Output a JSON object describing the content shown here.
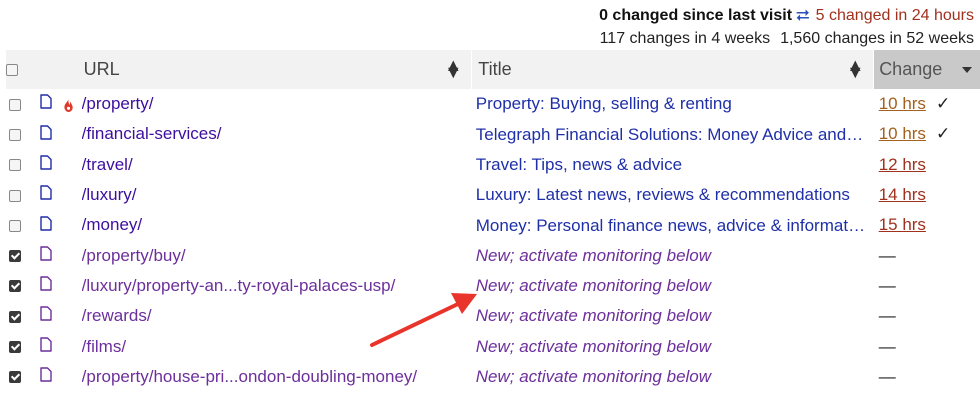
{
  "stats": {
    "since_last_visit": "0 changed since last visit",
    "changed_24h": "5 changed in 24 hours",
    "changes_4w": "117 changes in 4 weeks",
    "changes_52w": "1,560 changes in 52 weeks"
  },
  "columns": {
    "url": "URL",
    "title": "Title",
    "change": "Change"
  },
  "colors": {
    "url_link": "#3d0f9e",
    "new_item": "#6c2f9b",
    "title_link": "#1f2fa8",
    "hrs_orange": "#a3601e",
    "hrs_red": "#a0311d",
    "annotation_arrow": "#e8342a"
  },
  "rows": [
    {
      "checked": false,
      "hot": true,
      "url": "/property/",
      "title": "Property: Buying, selling & renting",
      "change": "10 hrs",
      "seen": "✓"
    },
    {
      "checked": false,
      "hot": false,
      "url": "/financial-services/",
      "title": "Telegraph Financial Solutions: Money Advice and …",
      "change": "10 hrs",
      "seen": "✓"
    },
    {
      "checked": false,
      "hot": false,
      "url": "/travel/",
      "title": "Travel: Tips, news & advice",
      "change": "12 hrs",
      "seen": ""
    },
    {
      "checked": false,
      "hot": false,
      "url": "/luxury/",
      "title": "Luxury: Latest news, reviews & recommendations",
      "change": "14 hrs",
      "seen": ""
    },
    {
      "checked": false,
      "hot": false,
      "url": "/money/",
      "title": "Money: Personal finance news, advice & informati…",
      "change": "15 hrs",
      "seen": ""
    },
    {
      "checked": true,
      "hot": false,
      "url": "/property/buy/",
      "title": "New; activate monitoring below",
      "change": "—",
      "seen": ""
    },
    {
      "checked": true,
      "hot": false,
      "url": "/luxury/property-an...ty-royal-palaces-usp/",
      "title": "New; activate monitoring below",
      "change": "—",
      "seen": ""
    },
    {
      "checked": true,
      "hot": false,
      "url": "/rewards/",
      "title": "New; activate monitoring below",
      "change": "—",
      "seen": ""
    },
    {
      "checked": true,
      "hot": false,
      "url": "/films/",
      "title": "New; activate monitoring below",
      "change": "—",
      "seen": ""
    },
    {
      "checked": true,
      "hot": false,
      "url": "/property/house-pri...ondon-doubling-money/",
      "title": "New; activate monitoring below",
      "change": "—",
      "seen": ""
    }
  ]
}
